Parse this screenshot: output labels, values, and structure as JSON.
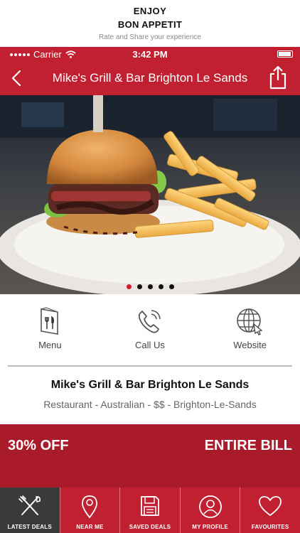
{
  "promo": {
    "line1": "ENJOY",
    "line2": "BON APPETIT",
    "line3": "Rate and Share your experience"
  },
  "status_bar": {
    "carrier": "Carrier",
    "time": "3:42 PM"
  },
  "navbar": {
    "title": "Mike's Grill & Bar Brighton Le Sands",
    "back_icon": "chevron-left-icon",
    "share_icon": "share-icon"
  },
  "gallery": {
    "image_subject": "burger-and-fries-photo",
    "page_count": 5,
    "active_page": 1
  },
  "actions": [
    {
      "label": "Menu",
      "icon": "menu-icon"
    },
    {
      "label": "Call Us",
      "icon": "phone-icon"
    },
    {
      "label": "Website",
      "icon": "globe-icon"
    }
  ],
  "venue": {
    "name": "Mike's Grill & Bar Brighton Le Sands",
    "meta": "Restaurant - Australian - $$ - Brighton-Le-Sands"
  },
  "deal": {
    "discount": "30% OFF",
    "scope": "ENTIRE BILL"
  },
  "tabs": [
    {
      "label": "LATEST DEALS",
      "icon": "cutlery-icon",
      "active": true
    },
    {
      "label": "NEAR ME",
      "icon": "location-pin-icon",
      "active": false
    },
    {
      "label": "SAVED DEALS",
      "icon": "save-icon",
      "active": false
    },
    {
      "label": "MY PROFILE",
      "icon": "user-icon",
      "active": false
    },
    {
      "label": "FAVOURITES",
      "icon": "heart-icon",
      "active": false
    }
  ],
  "colors": {
    "brand_red": "#c0202f",
    "deal_red": "#a91b2a",
    "active_tab": "#3a3a3a",
    "pager_active": "#d61b2b"
  }
}
